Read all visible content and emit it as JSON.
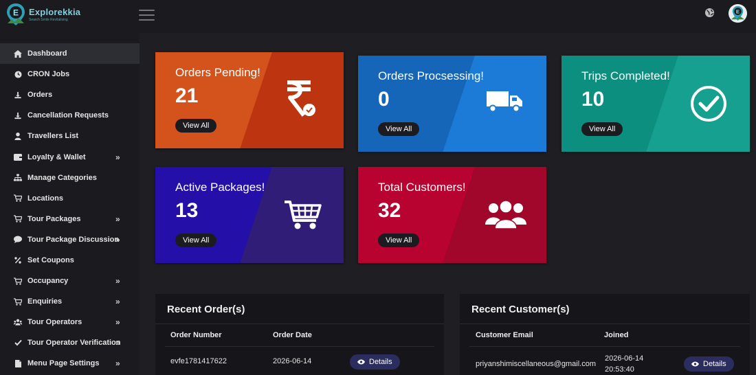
{
  "app": {
    "logo_title": "Explorekkia",
    "logo_subtitle": "Search Smile Revitalising"
  },
  "sidebar": {
    "items": [
      {
        "label": "Dashboard",
        "icon": "home-icon",
        "chevron": false,
        "active": true
      },
      {
        "label": "CRON Jobs",
        "icon": "clock-icon",
        "chevron": false
      },
      {
        "label": "Orders",
        "icon": "orders-icon",
        "chevron": false
      },
      {
        "label": "Cancellation Requests",
        "icon": "cancellation-icon",
        "chevron": false
      },
      {
        "label": "Travellers List",
        "icon": "user-icon",
        "chevron": false
      },
      {
        "label": "Loyalty & Wallet",
        "icon": "wallet-icon",
        "chevron": true
      },
      {
        "label": "Manage Categories",
        "icon": "sitemap-icon",
        "chevron": false
      },
      {
        "label": "Locations",
        "icon": "cart-icon",
        "chevron": false
      },
      {
        "label": "Tour Packages",
        "icon": "cart-icon",
        "chevron": true
      },
      {
        "label": "Tour Package Discussion",
        "icon": "comment-icon",
        "chevron": true
      },
      {
        "label": "Set Coupons",
        "icon": "percent-icon",
        "chevron": false
      },
      {
        "label": "Occupancy",
        "icon": "cart-icon",
        "chevron": true
      },
      {
        "label": "Enquiries",
        "icon": "cart-icon",
        "chevron": true
      },
      {
        "label": "Tour Operators",
        "icon": "users-icon",
        "chevron": true
      },
      {
        "label": "Tour Operator Verification",
        "icon": "check-icon",
        "chevron": true
      },
      {
        "label": "Menu Page Settings",
        "icon": "file-icon",
        "chevron": true
      }
    ],
    "chevron_glyph": "»"
  },
  "cards": [
    {
      "title": "Orders Pending!",
      "value": "21",
      "button": "View All",
      "icon": "rupee-icon",
      "color_left": "#d4521b",
      "color_right": "#bd3510"
    },
    {
      "title": "Orders Procsessing!",
      "value": "0",
      "button": "View All",
      "icon": "truck-icon",
      "color_left": "#1565b8",
      "color_right": "#1c7bd6"
    },
    {
      "title": "Trips Completed!",
      "value": "10",
      "button": "View All",
      "icon": "check-circle-icon",
      "color_left": "#0d8f80",
      "color_right": "#16a08f"
    },
    {
      "title": "Active Packages!",
      "value": "13",
      "button": "View All",
      "icon": "shopping-cart-icon",
      "color_left": "#2410a8",
      "color_right": "#2f1d78"
    },
    {
      "title": "Total Customers!",
      "value": "32",
      "button": "View All",
      "icon": "customers-icon",
      "color_left": "#b8022f",
      "color_right": "#a0072a"
    }
  ],
  "recent_orders": {
    "title": "Recent Order(s)",
    "columns": [
      "Order Number",
      "Order Date"
    ],
    "rows": [
      {
        "order_number": "evfe1781417622",
        "order_date": "2026-06-14",
        "action": "Details"
      }
    ]
  },
  "recent_customers": {
    "title": "Recent Customer(s)",
    "columns": [
      "Customer Email",
      "Joined"
    ],
    "rows": [
      {
        "email": "priyanshimiscellaneous@gmail.com",
        "joined_date": "2026-06-14",
        "joined_time": "20:53:40",
        "action": "Details"
      }
    ]
  }
}
